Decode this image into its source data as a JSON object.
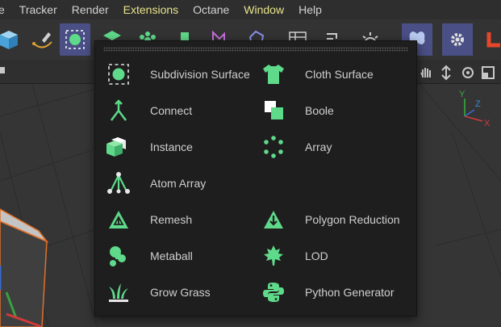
{
  "menubar": {
    "items": [
      {
        "label": "e",
        "highlight": false
      },
      {
        "label": "Tracker",
        "highlight": false
      },
      {
        "label": "Render",
        "highlight": false
      },
      {
        "label": "Extensions",
        "highlight": true
      },
      {
        "label": "Octane",
        "highlight": false
      },
      {
        "label": "Window",
        "highlight": true
      },
      {
        "label": "Help",
        "highlight": false
      }
    ]
  },
  "popup": {
    "left_column": [
      {
        "label": "Subdivision Surface",
        "icon": "subdivision-surface-icon"
      },
      {
        "label": "Connect",
        "icon": "connect-icon"
      },
      {
        "label": "Instance",
        "icon": "instance-icon"
      },
      {
        "label": "Atom Array",
        "icon": "atom-array-icon"
      },
      {
        "label": "Remesh",
        "icon": "remesh-icon"
      },
      {
        "label": "Metaball",
        "icon": "metaball-icon"
      },
      {
        "label": "Grow Grass",
        "icon": "grow-grass-icon"
      }
    ],
    "right_column": [
      {
        "label": "Cloth Surface",
        "icon": "cloth-surface-icon"
      },
      {
        "label": "Boole",
        "icon": "boole-icon"
      },
      {
        "label": "Array",
        "icon": "array-icon"
      },
      {
        "label": "Polygon Reduction",
        "icon": "polygon-reduction-icon"
      },
      {
        "label": "LOD",
        "icon": "lod-icon"
      },
      {
        "label": "Python Generator",
        "icon": "python-generator-icon"
      }
    ]
  },
  "colors": {
    "accent_green": "#5fd98a",
    "menu_highlight": "#e8e48a",
    "selected_tool_bg": "#4a4f86",
    "popup_bg": "#1e1e1e"
  },
  "axis_gizmo": {
    "y": "Y",
    "z": "Z",
    "x": "X"
  }
}
